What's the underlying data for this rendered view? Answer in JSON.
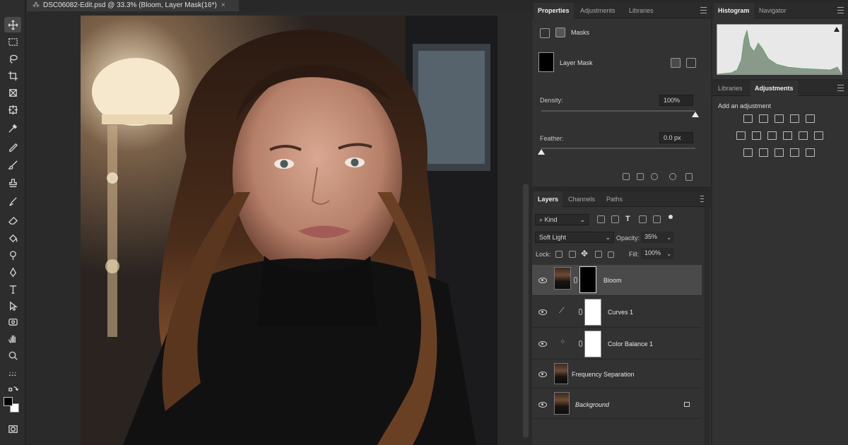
{
  "document": {
    "tab_title": "DSC06082-Edit.psd @ 33.3% (Bloom, Layer Mask(16*)",
    "close_glyph": "×"
  },
  "toolbar": {
    "tools": [
      "move-tool",
      "marquee-tool",
      "lasso-tool",
      "crop-tool",
      "frame-tool",
      "eyedropper-tool",
      "healing-brush-tool",
      "brush-tool",
      "clone-stamp-tool",
      "history-brush-tool",
      "eraser-tool",
      "gradient-tool",
      "blur-tool",
      "dodge-tool",
      "pen-tool",
      "type-tool",
      "path-selection-tool",
      "shape-tool",
      "hand-tool",
      "zoom-tool",
      "more-tools"
    ],
    "foreground_color": "#000000",
    "background_color": "#ffffff"
  },
  "properties": {
    "tabs": [
      "Properties",
      "Adjustments",
      "Libraries"
    ],
    "active_tab": "Properties",
    "masks_label": "Masks",
    "layer_mask_label": "Layer Mask",
    "density_label": "Density:",
    "density_value": "100%",
    "density_level": 1.0,
    "feather_label": "Feather:",
    "feather_value": "0.0 px",
    "feather_level": 0.0
  },
  "layers": {
    "tabs": [
      "Layers",
      "Channels",
      "Paths"
    ],
    "active_tab": "Layers",
    "filter_kind": "Kind",
    "blend_mode": "Soft Light",
    "opacity_label": "Opacity:",
    "opacity_value": "35%",
    "lock_label": "Lock:",
    "fill_label": "Fill:",
    "fill_value": "100%",
    "items": [
      {
        "name": "Bloom",
        "type": "pixel-with-mask",
        "mask": "black",
        "selected": true,
        "visible": true
      },
      {
        "name": "Curves 1",
        "type": "adjustment-curves",
        "mask": "white",
        "selected": false,
        "visible": true
      },
      {
        "name": "Color Balance 1",
        "type": "adjustment-color-balance",
        "mask": "white",
        "selected": false,
        "visible": true
      },
      {
        "name": "Frequency Separation",
        "type": "pixel",
        "selected": false,
        "visible": true
      },
      {
        "name": "Background",
        "type": "background",
        "locked": true,
        "italic": true,
        "selected": false,
        "visible": true
      }
    ]
  },
  "histogram": {
    "tabs": [
      "Histogram",
      "Navigator"
    ],
    "active_tab": "Histogram"
  },
  "adjustments": {
    "tabs": [
      "Libraries",
      "Adjustments"
    ],
    "active_tab": "Adjustments",
    "add_label": "Add an adjustment",
    "icons": [
      "brightness-contrast-icon",
      "levels-icon",
      "curves-icon",
      "exposure-icon",
      "vibrance-icon",
      "hue-saturation-icon",
      "color-balance-icon",
      "black-white-icon",
      "photo-filter-icon",
      "channel-mixer-icon",
      "color-lookup-icon",
      "invert-icon",
      "posterize-icon",
      "threshold-icon",
      "gradient-map-icon",
      "selective-color-icon"
    ]
  }
}
